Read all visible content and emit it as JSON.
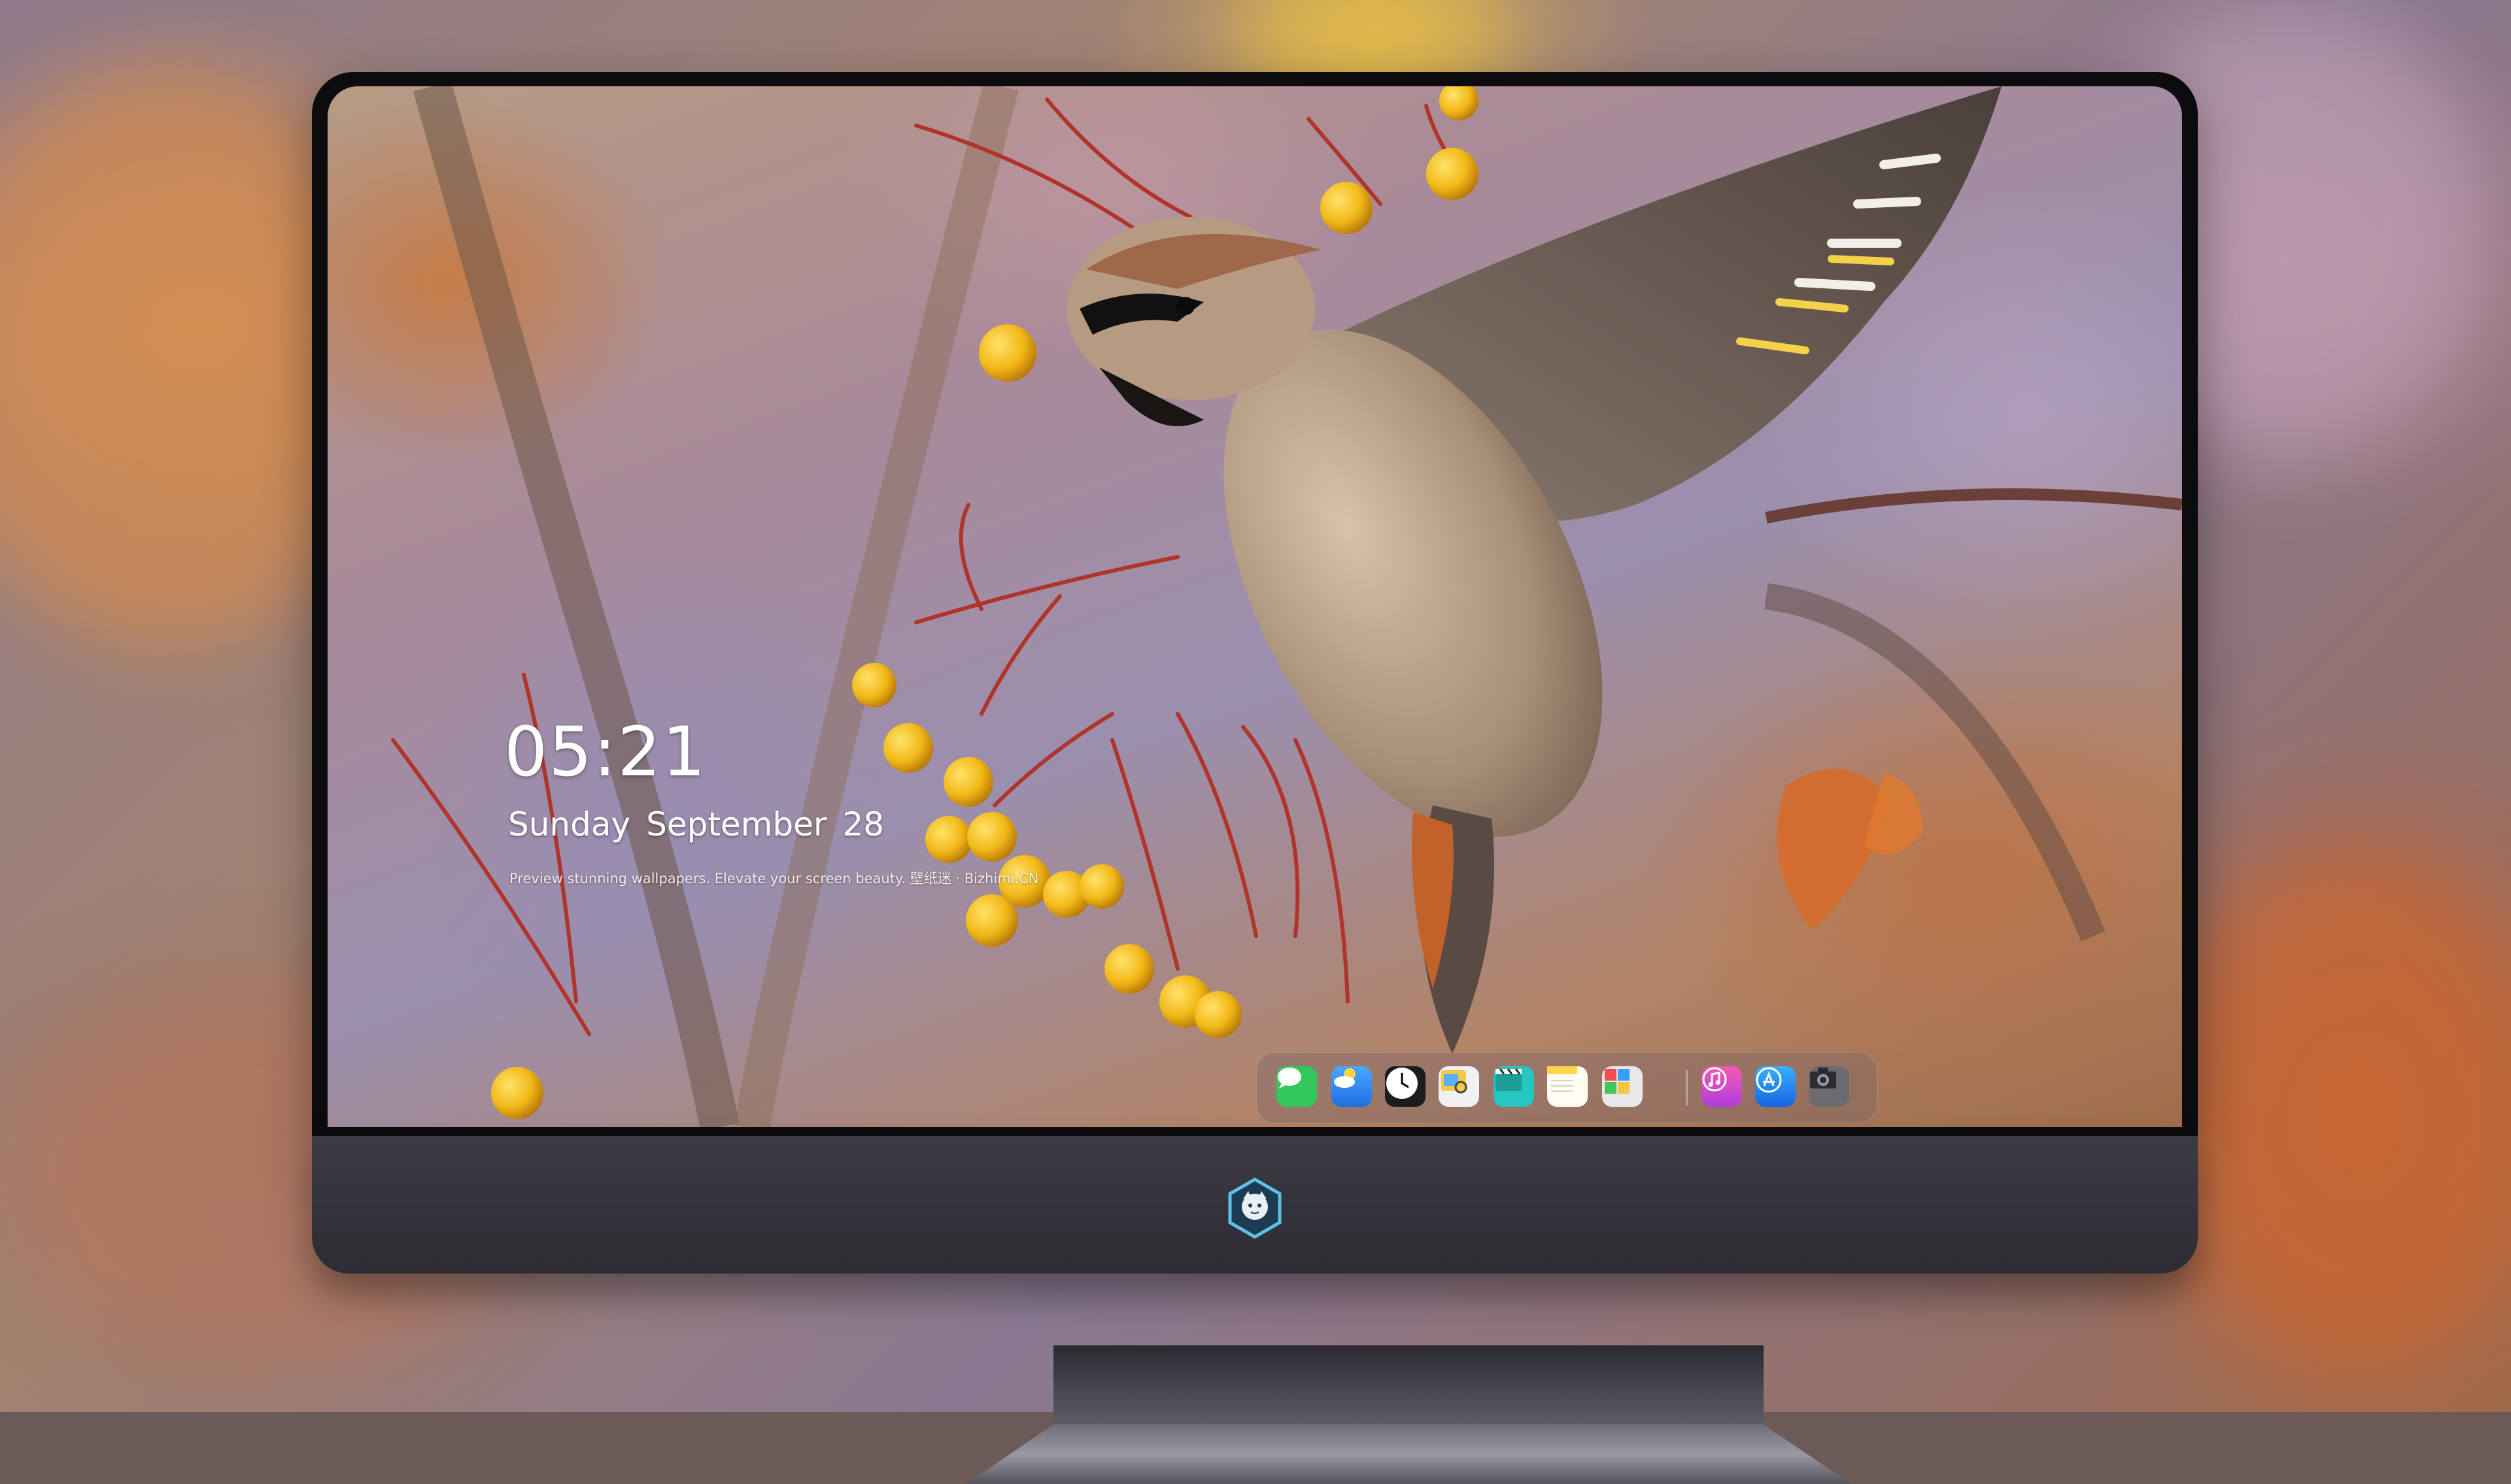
{
  "lockscreen": {
    "time": "05:21",
    "weekday": "Sunday",
    "month": "September",
    "day": "28",
    "tagline": "Preview stunning wallpapers. Elevate your screen beauty. 壁纸迷 · Bizhimi.CN"
  },
  "dock": {
    "apps": [
      {
        "name": "messages-icon",
        "color": "#34c759"
      },
      {
        "name": "weather-icon",
        "color": "#2f8cf0"
      },
      {
        "name": "clock-icon",
        "color": "#1c1c1e"
      },
      {
        "name": "preview-icon",
        "color": "#f5c84a"
      },
      {
        "name": "clips-icon",
        "color": "#26c6c2"
      },
      {
        "name": "notes-icon",
        "color": "#ffd54a"
      },
      {
        "name": "photo-booth-icon",
        "color": "#e8e8ea"
      },
      {
        "name": "itunes-icon",
        "color": "#e040a0"
      },
      {
        "name": "app-store-icon",
        "color": "#1e8af5"
      },
      {
        "name": "camera-icon",
        "color": "#6b6b70"
      }
    ]
  },
  "colors": {
    "frame": "#0c0c0e",
    "chin": "#35333b",
    "berry": "#f2b817",
    "branch": "#b0342a"
  }
}
